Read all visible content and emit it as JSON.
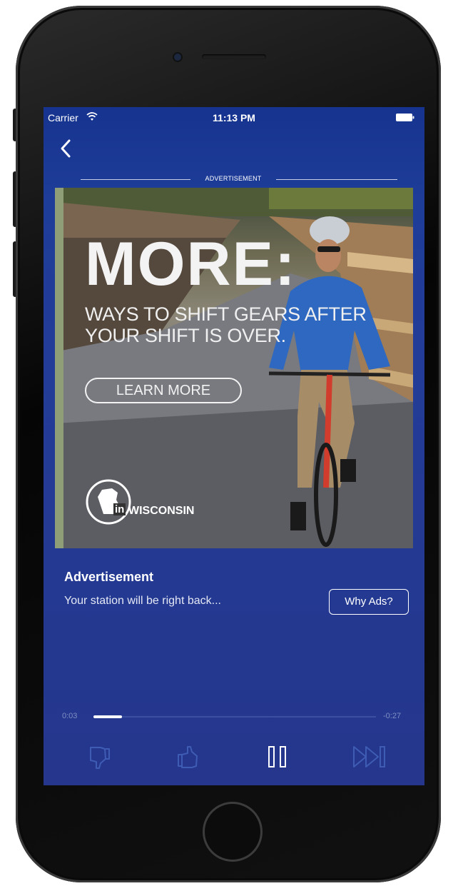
{
  "status_bar": {
    "carrier": "Carrier",
    "time": "11:13 PM"
  },
  "ad_header": {
    "label": "ADVERTISEMENT"
  },
  "ad_creative": {
    "headline": "MORE:",
    "subline_1": "WAYS TO SHIFT GEARS AFTER",
    "subline_2": "YOUR SHIFT IS OVER.",
    "cta": "LEARN MORE",
    "logo_text": "WISCONSIN",
    "logo_prefix": "in"
  },
  "info": {
    "title": "Advertisement",
    "subtitle": "Your station will be right back...",
    "why_ads_label": "Why Ads?"
  },
  "player": {
    "elapsed": "0:03",
    "remaining": "-0:27",
    "progress": 0.1
  },
  "colors": {
    "screen_blue": "#233c97",
    "accent_white": "#ffffff",
    "muted_control": "#3f5cb4"
  },
  "icons": [
    "back-icon",
    "wifi-icon",
    "battery-icon",
    "thumb-down-icon",
    "thumb-up-icon",
    "pause-icon",
    "skip-icon"
  ]
}
